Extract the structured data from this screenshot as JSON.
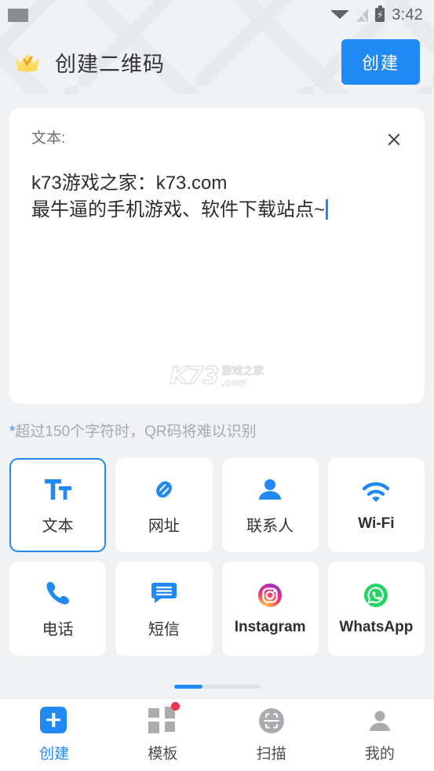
{
  "statusbar": {
    "keyboard_icon": "keyboard-icon",
    "wifi_icon": "wifi-icon",
    "signal_off_icon": "signal-off-icon",
    "battery_icon": "battery-charging-icon",
    "time": "3:42"
  },
  "appbar": {
    "crown_icon": "crown-icon",
    "title": "创建二维码",
    "create_label": "创建"
  },
  "text_card": {
    "label": "文本:",
    "close_icon": "close-icon",
    "content": "k73游戏之家：k73.com\n最牛逼的手机游戏、软件下载站点~",
    "watermark": {
      "logo": "K73",
      "cn": "游戏之家",
      "domain": ".com"
    }
  },
  "hint": {
    "star": "*",
    "text": "超过150个字符时，QR码将难以识别"
  },
  "types": [
    {
      "label": "文本",
      "icon": "text-format-icon",
      "selected": true,
      "style": "cn"
    },
    {
      "label": "网址",
      "icon": "link-icon",
      "selected": false,
      "style": "cn"
    },
    {
      "label": "联系人",
      "icon": "person-icon",
      "selected": false,
      "style": "cn"
    },
    {
      "label": "Wi-Fi",
      "icon": "wifi-icon",
      "selected": false,
      "style": "en"
    },
    {
      "label": "电话",
      "icon": "phone-icon",
      "selected": false,
      "style": "cn"
    },
    {
      "label": "短信",
      "icon": "message-icon",
      "selected": false,
      "style": "cn"
    },
    {
      "label": "Instagram",
      "icon": "instagram-icon",
      "selected": false,
      "style": "en"
    },
    {
      "label": "WhatsApp",
      "icon": "whatsapp-icon",
      "selected": false,
      "style": "en"
    }
  ],
  "tabs": [
    {
      "label": "创建",
      "icon": "plus-square-icon",
      "active": true,
      "badge": false
    },
    {
      "label": "模板",
      "icon": "grid-icon",
      "active": false,
      "badge": true
    },
    {
      "label": "扫描",
      "icon": "scan-icon",
      "active": false,
      "badge": false
    },
    {
      "label": "我的",
      "icon": "person-icon",
      "active": false,
      "badge": false
    }
  ],
  "colors": {
    "accent": "#2089f3",
    "background": "#f0f1f3",
    "card": "#ffffff",
    "badge": "#f0324b",
    "whatsapp": "#25d366"
  }
}
